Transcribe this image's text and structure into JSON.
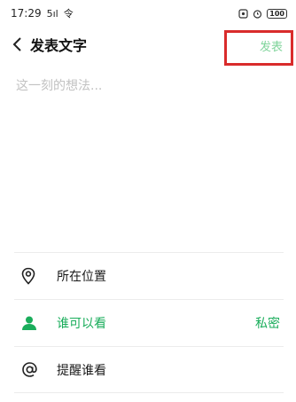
{
  "status_bar": {
    "time": "17:29",
    "signal": "5ıl",
    "network": "令",
    "battery": "100"
  },
  "header": {
    "title": "发表文字",
    "publish_label": "发表"
  },
  "compose": {
    "placeholder": "这一刻的想法..."
  },
  "options": [
    {
      "label": "所在位置",
      "icon": "location-pin-icon",
      "value": ""
    },
    {
      "label": "谁可以看",
      "icon": "person-icon",
      "value": "私密"
    },
    {
      "label": "提醒谁看",
      "icon": "at-icon",
      "value": ""
    }
  ],
  "colors": {
    "accent": "#1aad5b",
    "publish_disabled": "#7fd49a",
    "highlight": "#d92b2b"
  }
}
